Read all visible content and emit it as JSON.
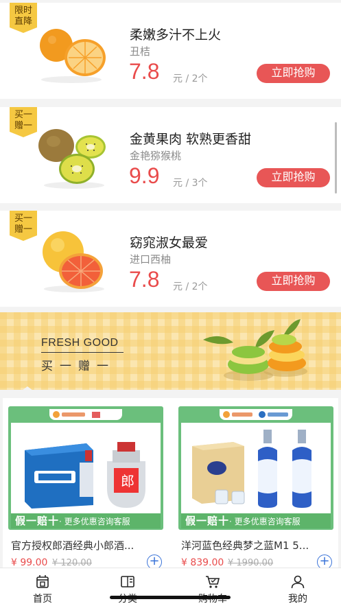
{
  "products": [
    {
      "badge": "限时\n直降",
      "badge_l1": "限时",
      "badge_l2": "直降",
      "title": "柔嫩多汁不上火",
      "sub": "丑桔",
      "price": "7.8",
      "unit": "元 / 2个",
      "button": "立即抢购",
      "fruit_icon": "orange"
    },
    {
      "badge_l1": "买一",
      "badge_l2": "赠一",
      "title": "金黄果肉 软熟更香甜",
      "sub": "金艳猕猴桃",
      "price": "9.9",
      "unit": "元 / 3个",
      "button": "立即抢购",
      "fruit_icon": "kiwi"
    },
    {
      "badge_l1": "买一",
      "badge_l2": "赠一",
      "title": "窈窕淑女最爱",
      "sub": "进口西柚",
      "price": "7.8",
      "unit": "元 / 2个",
      "button": "立即抢购",
      "fruit_icon": "grapefruit"
    }
  ],
  "banner": {
    "title_en": "FRESH GOOD",
    "title_cn": "买一赠一"
  },
  "grid": [
    {
      "tag_main": "假一赔十",
      "tag_sub": "· 更多优惠咨询客服",
      "title": "官方授权郎酒经典小郎酒...",
      "price": "¥ 99.00",
      "old_price": "¥ 120.00"
    },
    {
      "tag_main": "假一赔十",
      "tag_sub": "· 更多优惠咨询客服",
      "title": "洋河蓝色经典梦之蓝M1 5...",
      "price": "¥ 839.00",
      "old_price": "¥ 1990.00"
    }
  ],
  "tabs": [
    {
      "label": "首页",
      "icon": "home-icon"
    },
    {
      "label": "分类",
      "icon": "category-icon"
    },
    {
      "label": "购物车",
      "icon": "cart-icon"
    },
    {
      "label": "我的",
      "icon": "user-icon"
    }
  ],
  "colors": {
    "accent": "#e85656",
    "price": "#e94b4b",
    "tag_green": "#5db46a",
    "badge_yellow": "#f5c842"
  }
}
